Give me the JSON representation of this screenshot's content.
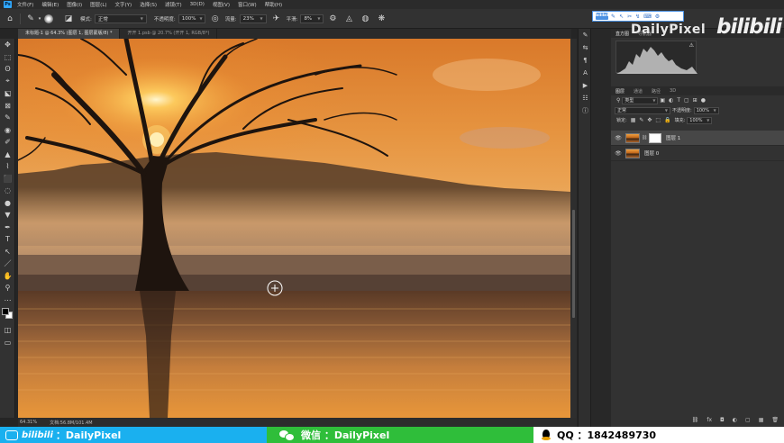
{
  "menu": {
    "app_logo": "Ps",
    "items": [
      "文件(F)",
      "编辑(E)",
      "图像(I)",
      "图层(L)",
      "文字(Y)",
      "选择(S)",
      "滤镜(T)",
      "3D(D)",
      "视图(V)",
      "窗口(W)",
      "帮助(H)"
    ]
  },
  "options": {
    "mode_label": "模式:",
    "mode_value": "正常",
    "opacity_label": "不透明度:",
    "opacity_value": "100%",
    "flow_label": "流量:",
    "flow_value": "23%",
    "smooth_label": "平滑:",
    "smooth_value": "8%"
  },
  "hintbar": {
    "logo": "bilibili",
    "glyphs": [
      "✎",
      "↖",
      "✂",
      "↯",
      "⌨",
      "⚙"
    ]
  },
  "watermark": {
    "text": "DailyPixel",
    "bili": "bilibili"
  },
  "tabs": [
    {
      "label": "未标题-1 @ 64.3% (图层 1, 图层蒙版/8) *",
      "active": true
    },
    {
      "label": "开开 1.psb @ 20.7% (开开 1, RGB/8*)",
      "active": false
    }
  ],
  "tools": [
    "✥",
    "⬚",
    "ʘ",
    "⌖",
    "⬕",
    "⊠",
    "✎",
    "◉",
    "✐",
    "▲",
    "⌇",
    "⬛",
    "◌",
    "●",
    "▼",
    "✒",
    "T",
    "↖",
    "／",
    "✋",
    "⚲",
    "⋯"
  ],
  "status": {
    "zoom": "64.31%",
    "doc": "文档:56.8M/101.4M"
  },
  "panelstrip": [
    "✎",
    "⇆",
    "¶",
    "A",
    "▶",
    "☷",
    "ⓘ"
  ],
  "histogram": {
    "tabs": [
      "直方图",
      "导航器"
    ],
    "warning_icon": "⚠"
  },
  "layers": {
    "tabs": [
      "图层",
      "通道",
      "路径",
      "3D"
    ],
    "filter_value": "类型",
    "blend_value": "正常",
    "opacity_label": "不透明度:",
    "opacity_value": "100%",
    "lock_label": "锁定:",
    "fill_label": "填充:",
    "fill_value": "100%",
    "items": [
      {
        "name": "图层 1",
        "selected": true,
        "has_mask": true
      },
      {
        "name": "图层 0",
        "selected": false,
        "has_mask": false
      }
    ],
    "footer_icons": [
      "⛓",
      "fx",
      "◘",
      "◐",
      "▢",
      "▦",
      "🗑"
    ]
  },
  "banner": {
    "bili_prefix": "bilibili",
    "bili_text": "：DailyPixel",
    "wechat_text": "微信 ：DailyPixel",
    "qq_text": "QQ ：1842489730"
  }
}
